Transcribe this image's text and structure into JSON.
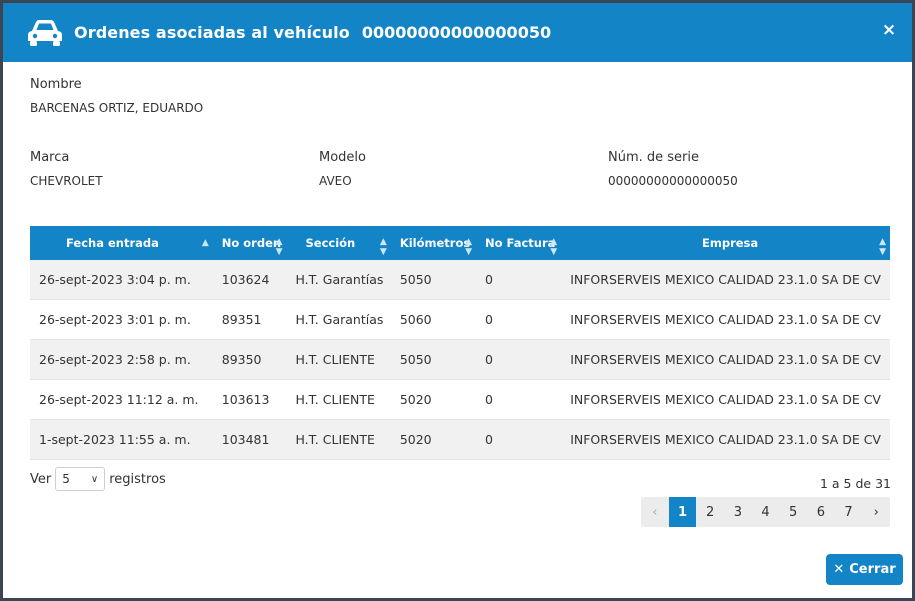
{
  "header": {
    "title": "Ordenes asociadas al vehículo",
    "vehicle_id": "00000000000000050",
    "close_label": "×"
  },
  "fields": {
    "nombre_label": "Nombre",
    "nombre_value": "BARCENAS ORTIZ, EDUARDO",
    "marca_label": "Marca",
    "marca_value": "CHEVROLET",
    "modelo_label": "Modelo",
    "modelo_value": "AVEO",
    "serie_label": "Núm. de serie",
    "serie_value": "00000000000000050"
  },
  "table": {
    "columns": [
      "Fecha entrada",
      "No orden",
      "Sección",
      "Kilómetros",
      "No Factura",
      "Empresa"
    ],
    "rows": [
      [
        "26-sept-2023 3:04 p. m.",
        "103624",
        "H.T. Garantías",
        "5050",
        "0",
        "INFORSERVEIS MEXICO CALIDAD 23.1.0 SA DE CV"
      ],
      [
        "26-sept-2023 3:01 p. m.",
        "89351",
        "H.T. Garantías",
        "5060",
        "0",
        "INFORSERVEIS MEXICO CALIDAD 23.1.0 SA DE CV"
      ],
      [
        "26-sept-2023 2:58 p. m.",
        "89350",
        "H.T. CLIENTE",
        "5050",
        "0",
        "INFORSERVEIS MEXICO CALIDAD 23.1.0 SA DE CV"
      ],
      [
        "26-sept-2023 11:12 a. m.",
        "103613",
        "H.T. CLIENTE",
        "5020",
        "0",
        "INFORSERVEIS MEXICO CALIDAD 23.1.0 SA DE CV"
      ],
      [
        "1-sept-2023 11:55 a. m.",
        "103481",
        "H.T. CLIENTE",
        "5020",
        "0",
        "INFORSERVEIS MEXICO CALIDAD 23.1.0 SA DE CV"
      ]
    ]
  },
  "footer": {
    "ver_label": "Ver",
    "page_size": "5",
    "registros_label": "registros",
    "count_info": "1 a 5 de 31",
    "pages": [
      "‹",
      "1",
      "2",
      "3",
      "4",
      "5",
      "6",
      "7",
      "›"
    ],
    "active_page": "1",
    "cerrar_label": "Cerrar"
  },
  "colors": {
    "primary": "#1385c7",
    "row_alt": "#f1f1f1"
  }
}
